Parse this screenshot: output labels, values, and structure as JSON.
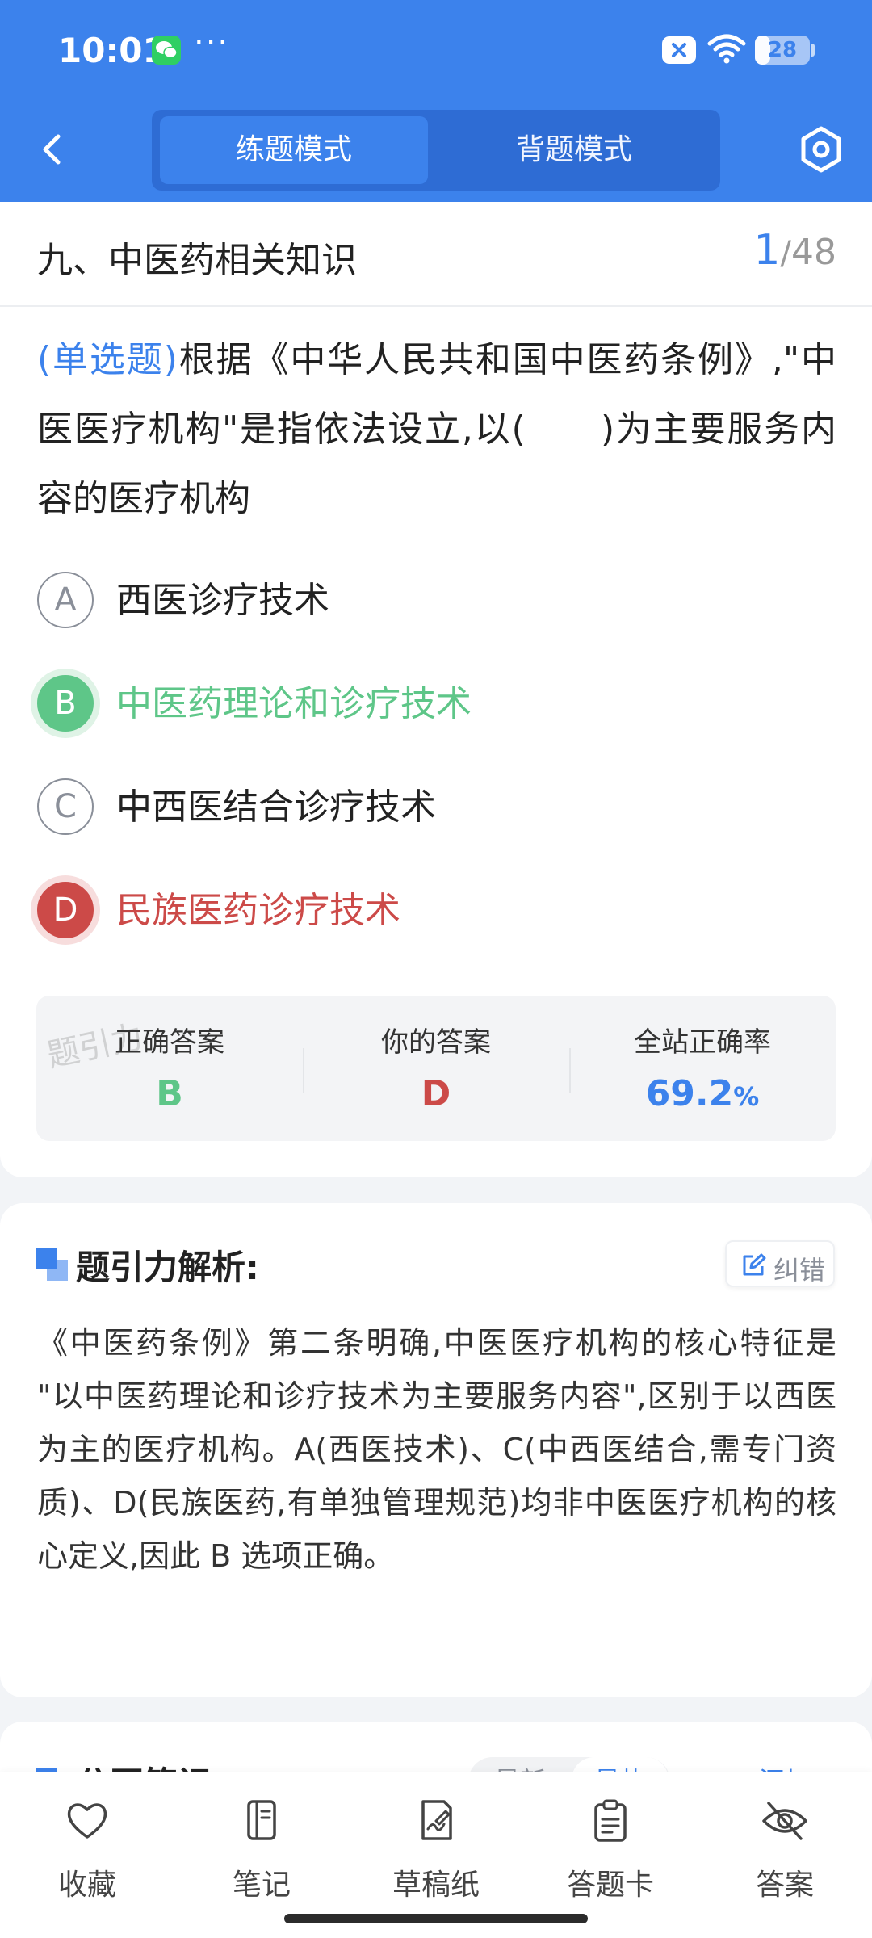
{
  "status_bar": {
    "time": "10:01",
    "more": "···",
    "battery": "28",
    "battery_level": 0.28
  },
  "nav": {
    "tabs": [
      {
        "label": "练题模式",
        "active": true
      },
      {
        "label": "背题模式",
        "active": false
      }
    ],
    "icons": [
      "back-chevron-icon",
      "settings-hexagon-icon"
    ]
  },
  "question": {
    "section": "九、中医药相关知识",
    "current": "1",
    "separator": "/",
    "total": "48",
    "type_label": "(单选题)",
    "text": "根据《中华人民共和国中医药条例》,\"中医医疗机构\"是指依法设立,以(　　)为主要服务内容的医疗机构"
  },
  "options": [
    {
      "letter": "A",
      "text": "西医诊疗技术",
      "state": "normal"
    },
    {
      "letter": "B",
      "text": "中医药理论和诊疗技术",
      "state": "correct"
    },
    {
      "letter": "C",
      "text": "中西医结合诊疗技术",
      "state": "normal"
    },
    {
      "letter": "D",
      "text": "民族医药诊疗技术",
      "state": "wrong"
    }
  ],
  "summary": {
    "correct_label": "正确答案",
    "correct_value": "B",
    "yours_label": "你的答案",
    "yours_value": "D",
    "rate_label": "全站正确率",
    "rate_value": "69.2",
    "rate_unit": "%",
    "watermark": "题引力"
  },
  "explanation": {
    "title": "题引力解析:",
    "correction_label": "纠错",
    "text": "《中医药条例》第二条明确,中医医疗机构的核心特征是 \"以中医药理论和诊疗技术为主要服务内容\",区别于以西医为主的医疗机构。A(西医技术)、C(中西医结合,需专门资质)、D(民族医药,有单独管理规范)均非中医医疗机构的核心定义,因此 B 选项正确。"
  },
  "notes": {
    "title": "公开笔记:",
    "sort_latest": "最新",
    "sort_hottest": "最热",
    "add_label": "添加"
  },
  "bottom_bar": {
    "items": [
      {
        "label": "收藏",
        "icon": "heart-icon"
      },
      {
        "label": "笔记",
        "icon": "notebook-icon"
      },
      {
        "label": "草稿纸",
        "icon": "draft-paper-icon"
      },
      {
        "label": "答题卡",
        "icon": "answer-sheet-icon"
      },
      {
        "label": "答案",
        "icon": "eye-slash-icon"
      }
    ]
  },
  "colors": {
    "primary": "#3c82ec",
    "correct": "#5ec688",
    "wrong": "#cc4a48"
  }
}
